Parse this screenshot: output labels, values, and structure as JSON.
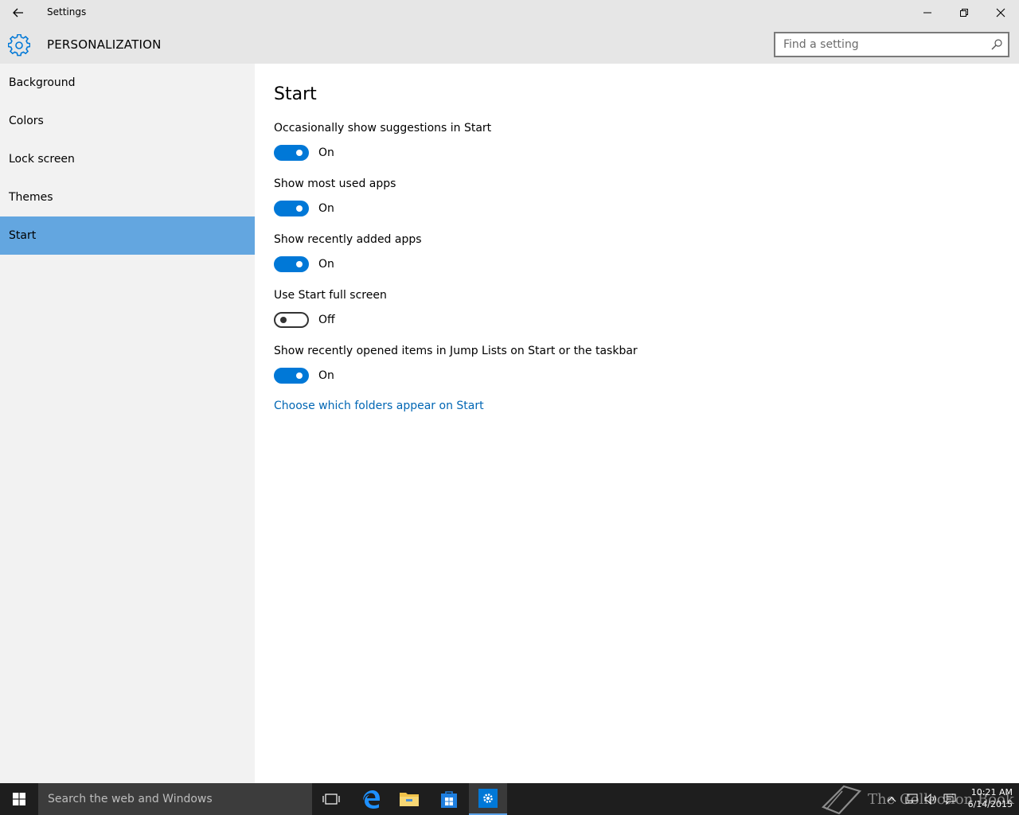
{
  "window": {
    "title": "Settings",
    "back_icon": "back-arrow-icon",
    "minimize_icon": "minimize-icon",
    "restore_icon": "restore-icon",
    "close_icon": "close-icon"
  },
  "header": {
    "icon": "gear-icon",
    "title": "PERSONALIZATION",
    "search_placeholder": "Find a setting",
    "search_value": ""
  },
  "sidebar": {
    "items": [
      {
        "label": "Background",
        "active": false
      },
      {
        "label": "Colors",
        "active": false
      },
      {
        "label": "Lock screen",
        "active": false
      },
      {
        "label": "Themes",
        "active": false
      },
      {
        "label": "Start",
        "active": true
      }
    ]
  },
  "main": {
    "title": "Start",
    "settings": [
      {
        "label": "Occasionally show suggestions in Start",
        "state": "On"
      },
      {
        "label": "Show most used apps",
        "state": "On"
      },
      {
        "label": "Show recently added apps",
        "state": "On"
      },
      {
        "label": "Use Start full screen",
        "state": "Off"
      },
      {
        "label": "Show recently opened items in Jump Lists on Start or the taskbar",
        "state": "On"
      }
    ],
    "link": "Choose which folders appear on Start"
  },
  "taskbar": {
    "search_placeholder": "Search the web and Windows",
    "watermark": "The Collection Book",
    "time": "10:21 AM",
    "date": "6/14/2015"
  },
  "colors": {
    "accent": "#0078d7",
    "sidebar_active": "#63a6e0",
    "link": "#0066b4",
    "taskbar": "#1e1e1e"
  }
}
